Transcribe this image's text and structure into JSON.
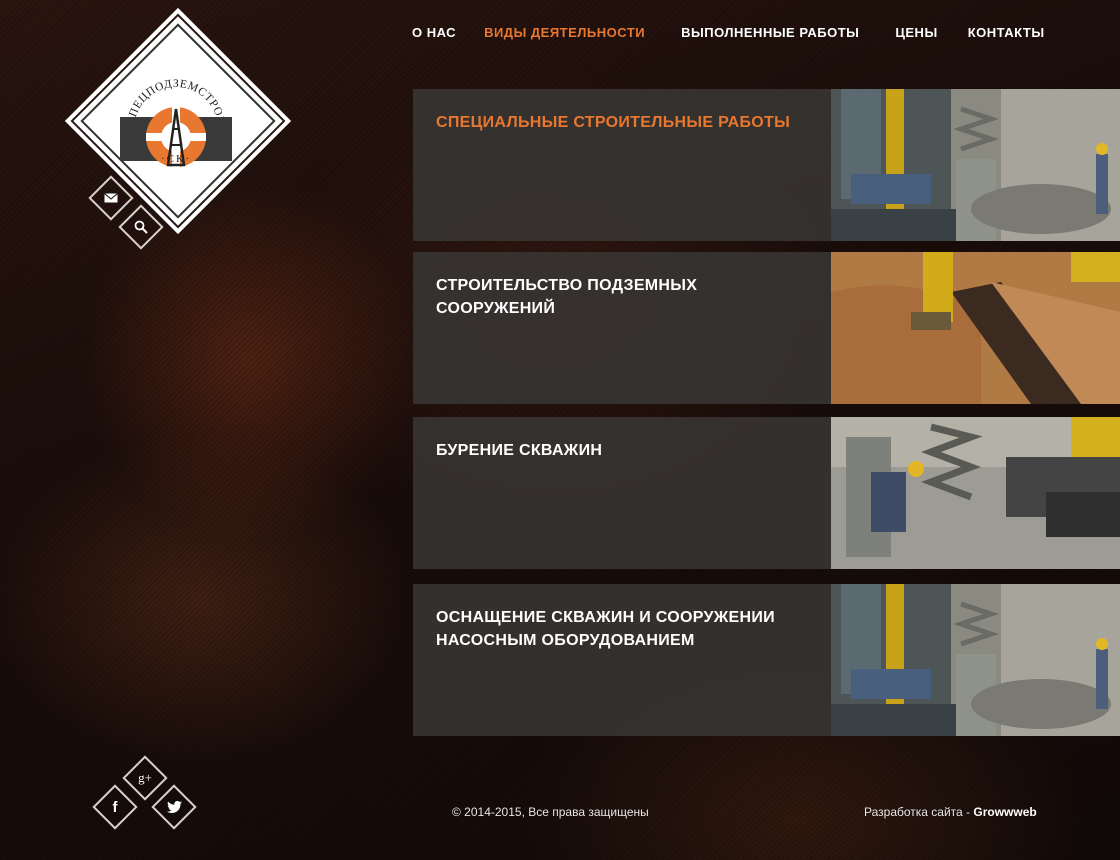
{
  "brand": {
    "arc_text": "СПЕЦПОДЗЕМСТРОЙ",
    "sub_text": "·СК·"
  },
  "header": {
    "icons": {
      "mail": "envelope-icon",
      "search": "search-icon"
    }
  },
  "nav": {
    "items": [
      {
        "label": "О НАС",
        "active": false
      },
      {
        "label": "ВИДЫ ДЕЯТЕЛЬНОСТИ",
        "active": true
      },
      {
        "label": "ВЫПОЛНЕННЫЕ РАБОТЫ",
        "active": false
      },
      {
        "label": "ЦЕНЫ",
        "active": false
      },
      {
        "label": "КОНТАКТЫ",
        "active": false
      }
    ]
  },
  "services": [
    {
      "title": "СПЕЦИАЛЬНЫЕ СТРОИТЕЛЬНЫЕ РАБОТЫ",
      "highlight": true,
      "photo": "drilling-rig-photo"
    },
    {
      "title": "СТРОИТЕЛЬСТВО ПОДЗЕМНЫХ СООРУЖЕНИЙ",
      "highlight": false,
      "photo": "excavation-trench-photo"
    },
    {
      "title": "БУРЕНИЕ СКВАЖИН",
      "highlight": false,
      "photo": "well-drilling-photo"
    },
    {
      "title": "ОСНАЩЕНИЕ СКВАЖИН И СООРУЖЕНИИ НАСОСНЫМ ОБОРУДОВАНИЕМ",
      "highlight": false,
      "photo": "drilling-rig-photo"
    }
  ],
  "social": {
    "gplus": "g+",
    "facebook": "f",
    "twitter": "twitter-icon"
  },
  "footer": {
    "copyright": "© 2014-2015, Все права защищены",
    "dev_prefix": "Разработка сайта - ",
    "dev_name": "Growwweb"
  },
  "colors": {
    "accent": "#e8772f",
    "card_bg": "#373432",
    "logo_orange": "#e8772f"
  }
}
